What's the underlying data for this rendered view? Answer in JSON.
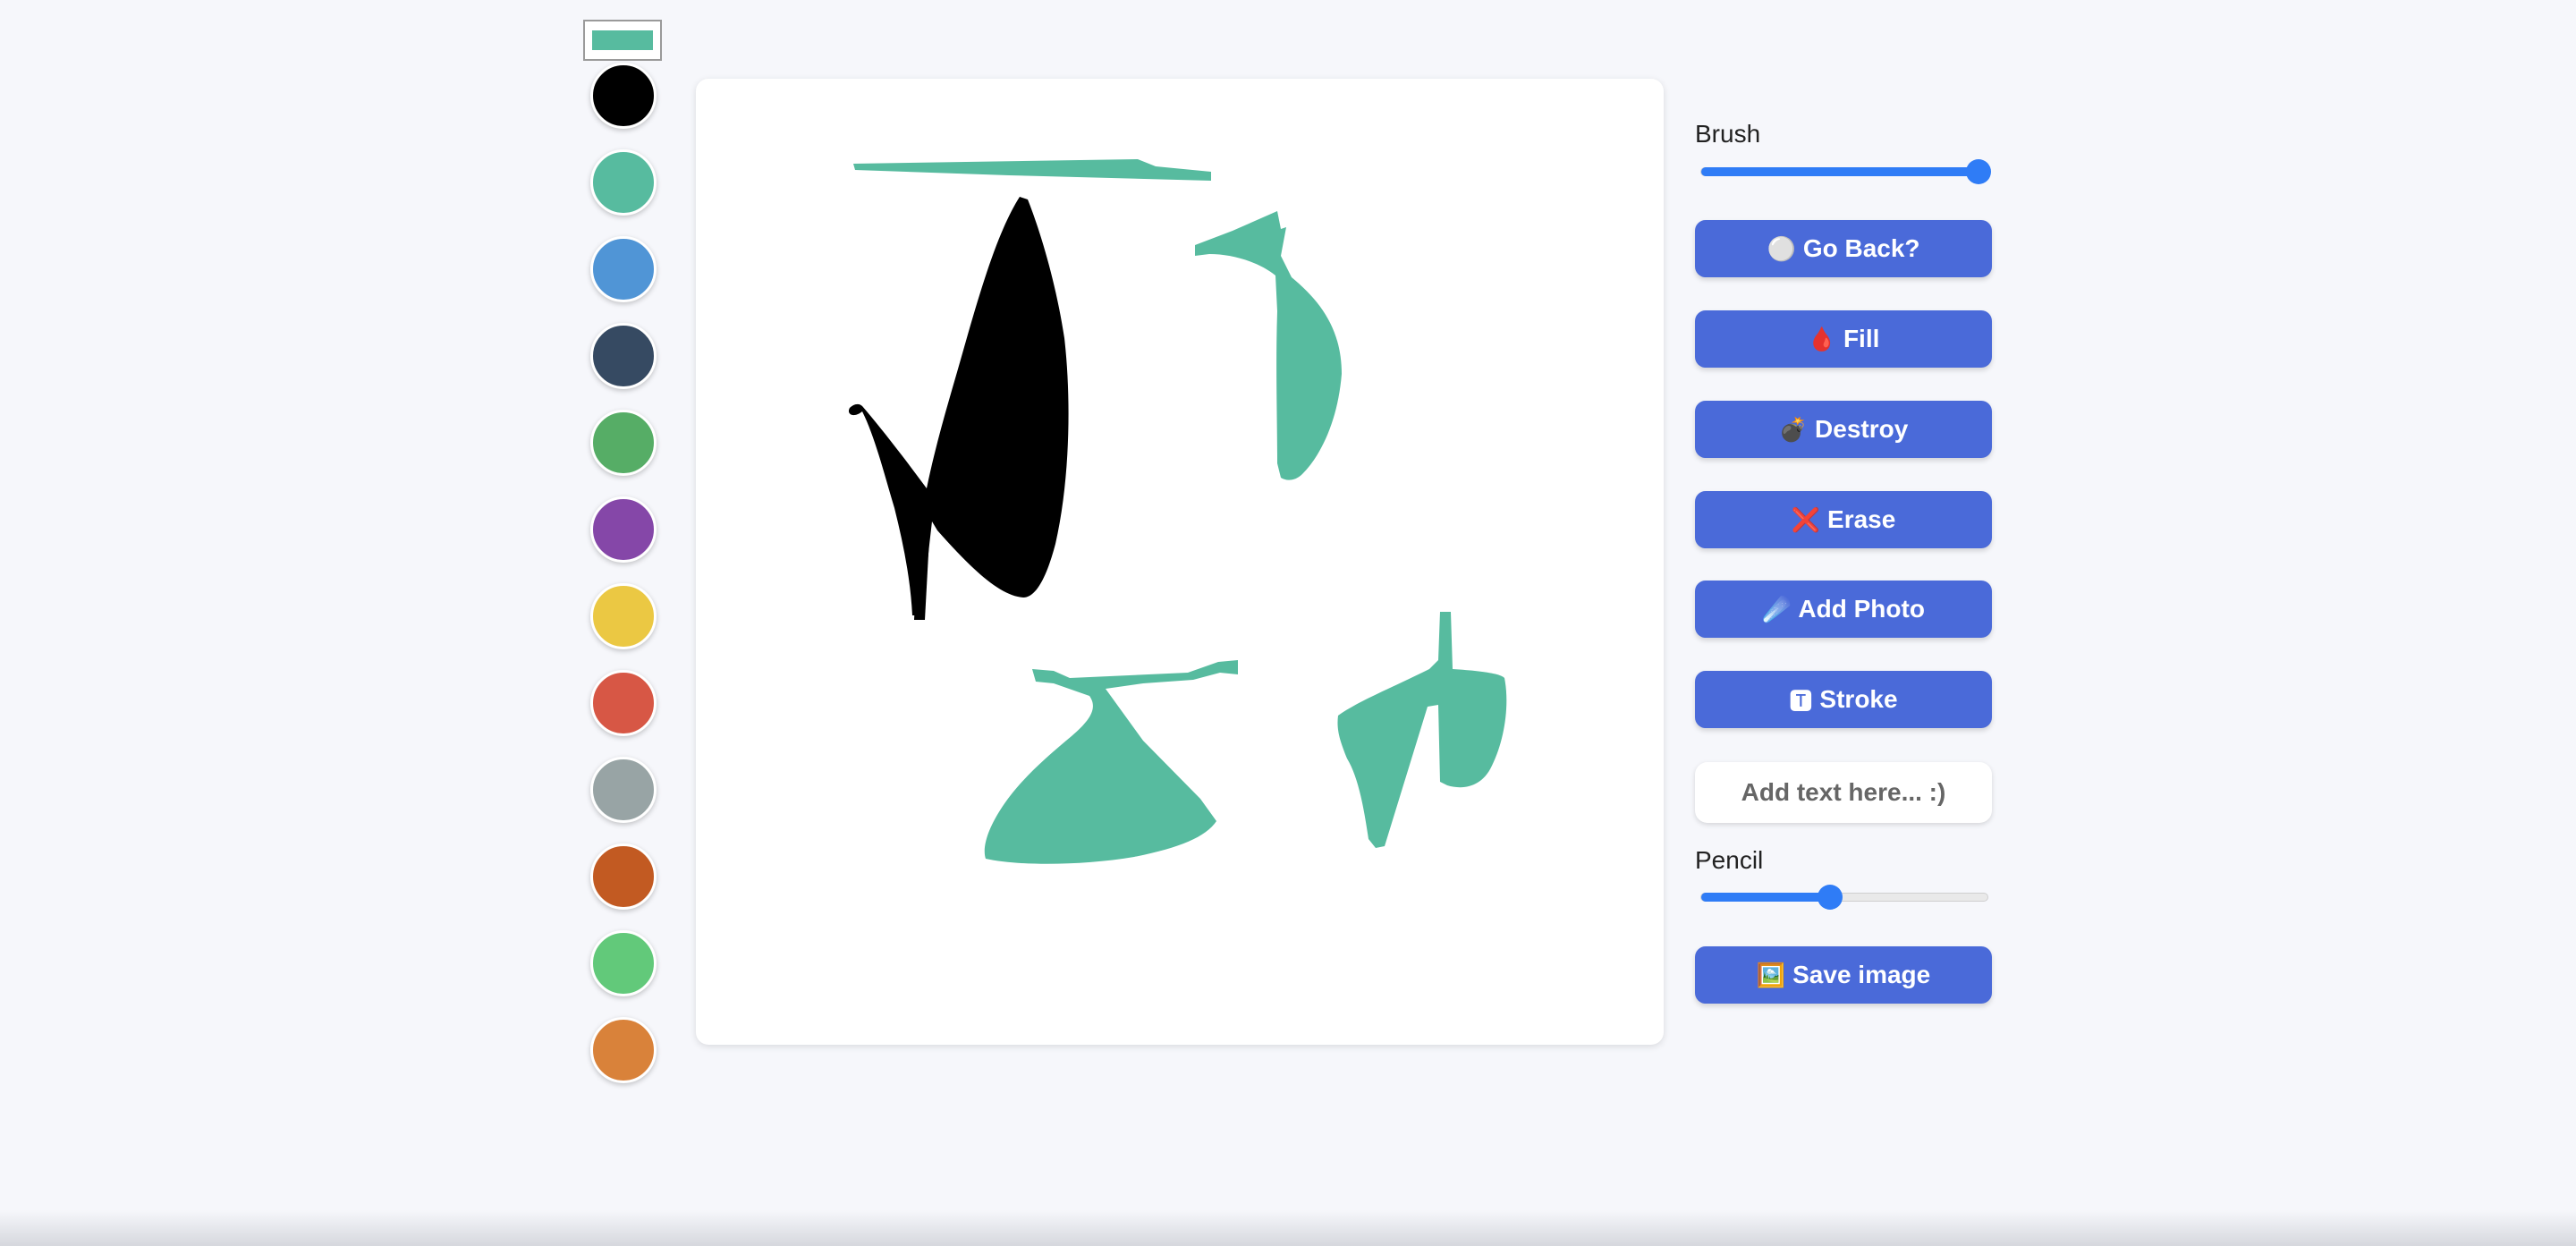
{
  "palette": {
    "selected_color": "#57bb9f",
    "colors": [
      "#000000",
      "#57bb9f",
      "#5095d6",
      "#364a62",
      "#56ad66",
      "#8547a8",
      "#ebc843",
      "#d75745",
      "#98a4a5",
      "#c25a22",
      "#62c97a",
      "#d9823a"
    ]
  },
  "drawing": {
    "colors": {
      "black": "#000000",
      "teal": "#57bb9f"
    }
  },
  "controls": {
    "brush_label": "Brush",
    "brush_value_fraction": 0.97,
    "buttons": {
      "go_back": {
        "icon": "⚪",
        "label": "Go Back?"
      },
      "fill": {
        "icon": "🩸",
        "label": "Fill"
      },
      "destroy": {
        "icon": "💣",
        "label": "Destroy"
      },
      "erase": {
        "icon": "❌",
        "label": "Erase"
      },
      "add_photo": {
        "icon": "☄️",
        "label": "Add Photo"
      },
      "stroke": {
        "icon": "🆃",
        "label": "Stroke"
      },
      "save": {
        "icon": "🖼️",
        "label": "Save image"
      }
    },
    "text_input_placeholder": "Add text here... :)",
    "pencil_label": "Pencil",
    "pencil_value_fraction": 0.45
  },
  "colors": {
    "button_bg": "#4a6ad9",
    "slider_accent": "#2f7cf6",
    "page_bg": "#f6f7fb"
  }
}
